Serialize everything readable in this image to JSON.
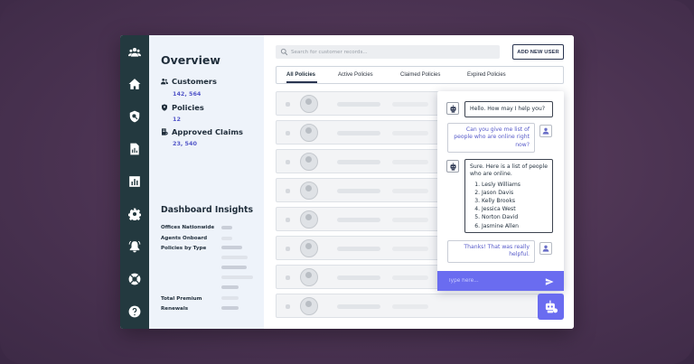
{
  "sidebar": {
    "icons": [
      "users-icon",
      "home-icon",
      "shield-search-icon",
      "report-icon",
      "bar-chart-icon",
      "gear-icon",
      "bell-icon",
      "support-icon",
      "help-icon"
    ]
  },
  "overview": {
    "title": "Overview",
    "stats": [
      {
        "label": "Customers",
        "value": "142, 564",
        "icon": "customers-icon"
      },
      {
        "label": "Policies",
        "value": "12",
        "icon": "policy-shield-icon"
      },
      {
        "label": "Approved Claims",
        "value": "23, 540",
        "icon": "claims-icon"
      }
    ]
  },
  "insights": {
    "title": "Dashboard Insights",
    "labels": [
      "Offices Nationwide",
      "Agents Onboard",
      "Policies by Type",
      "Total Premium",
      "Renewals"
    ]
  },
  "search": {
    "placeholder": "Search for customer records..."
  },
  "toolbar": {
    "add_user_label": "ADD NEW USER"
  },
  "tabs": [
    {
      "label": "All Policies",
      "active": true
    },
    {
      "label": "Active Policies",
      "active": false
    },
    {
      "label": "Claimed Policies",
      "active": false
    },
    {
      "label": "Expired Policies",
      "active": false
    }
  ],
  "chat": {
    "bot_greeting": "Hello. How may I help you?",
    "user_question": "Can you give me list of people who are online right now?",
    "bot_answer_intro": "Sure. Here is a list of people who are online.",
    "online_people": [
      "Lesly Williams",
      "Jason Davis",
      "Kelly Brooks",
      "Jessica West",
      "Norton David",
      "Jasmine Allen"
    ],
    "user_thanks": "Thanks! That was really helpful.",
    "input_placeholder": "Type here..."
  },
  "colors": {
    "accent": "#6a6cf0",
    "rail": "#23393f",
    "panel": "#eef3fa",
    "value": "#5559c9"
  }
}
